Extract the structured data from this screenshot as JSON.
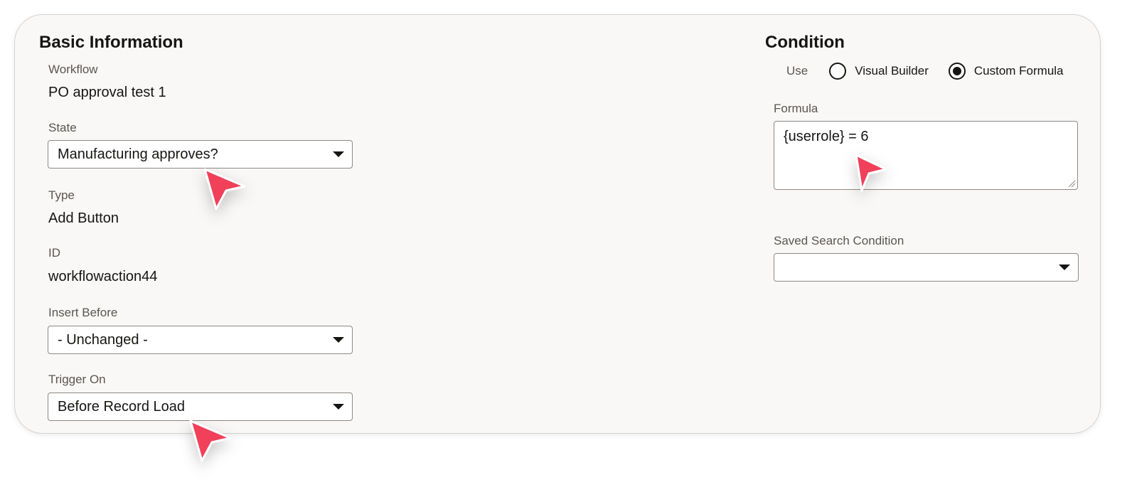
{
  "basic": {
    "title": "Basic Information",
    "workflow_label": "Workflow",
    "workflow_value": "PO approval test 1",
    "state_label": "State",
    "state_value": "Manufacturing approves?",
    "type_label": "Type",
    "type_value": "Add Button",
    "id_label": "ID",
    "id_value": "workflowaction44",
    "insert_before_label": "Insert Before",
    "insert_before_value": "- Unchanged -",
    "trigger_on_label": "Trigger On",
    "trigger_on_value": "Before Record Load"
  },
  "condition": {
    "title": "Condition",
    "use_label": "Use",
    "options": [
      "Visual Builder",
      "Custom Formula"
    ],
    "selected_option": "Custom Formula",
    "formula_label": "Formula",
    "formula_value": "{userrole} = 6",
    "saved_search_label": "Saved Search Condition",
    "saved_search_value": ""
  },
  "colors": {
    "cursor": "#f0405a",
    "card_background": "#f9f8f6"
  },
  "icons": {
    "dropdown": "caret-down-icon",
    "pointer": "mouse-pointer-icon"
  }
}
